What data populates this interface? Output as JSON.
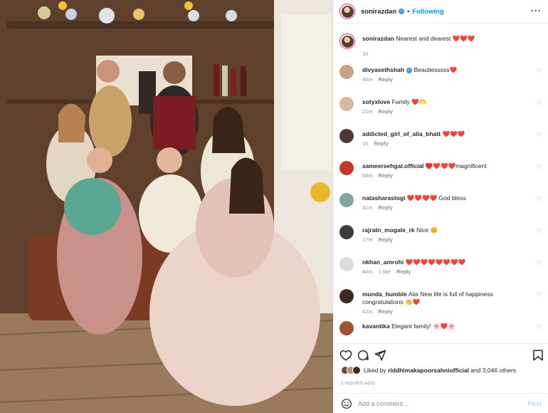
{
  "post": {
    "username": "sonirazdan",
    "follow_state": "Following",
    "more_icon": "more-horizontal-icon"
  },
  "caption": {
    "username": "sonirazdan",
    "text": "Nearest and dearest ❤️❤️❤️",
    "time": "1h"
  },
  "comments": [
    {
      "username": "divyasethshah",
      "verified": true,
      "text": "Beautiesssss❤️",
      "time": "40m",
      "likes": "",
      "reply": "Reply"
    },
    {
      "username": "sotyxlove",
      "verified": false,
      "text": "Family ❤️🫶",
      "time": "21m",
      "likes": "",
      "reply": "Reply"
    },
    {
      "username": "addicted_girl_of_alia_bhatt",
      "verified": false,
      "text": "❤️❤️❤️",
      "time": "1h",
      "likes": "",
      "reply": "Reply"
    },
    {
      "username": "sameersehgal.official",
      "verified": false,
      "text": "♥️❤️❤️❤️magnificent",
      "time": "54m",
      "likes": "",
      "reply": "Reply"
    },
    {
      "username": "natasharastogi",
      "verified": false,
      "text": "❤️❤️❤️❤️ God bless",
      "time": "41m",
      "likes": "",
      "reply": "Reply"
    },
    {
      "username": "rajratn_mogale_rk",
      "verified": false,
      "text": "Nice 😊",
      "time": "17m",
      "likes": "",
      "reply": "Reply"
    },
    {
      "username": "nkhan_amrohi",
      "verified": false,
      "text": "❤️❤️❤️❤️❤️❤️❤️❤️",
      "time": "44m",
      "likes": "1 like",
      "reply": "Reply"
    },
    {
      "username": "munda_humble",
      "verified": false,
      "text": "Alia New life is full of happiness congratulations 👏❤️",
      "time": "42m",
      "likes": "",
      "reply": "Reply"
    },
    {
      "username": "kavantika",
      "verified": false,
      "text": "Elegant family! 🌸❤️🌸",
      "time": "",
      "likes": "",
      "reply": ""
    }
  ],
  "actions": {
    "like_icon": "heart-icon",
    "comment_icon": "comment-icon",
    "share_icon": "send-icon",
    "save_icon": "bookmark-icon"
  },
  "liked_by": {
    "prefix": "Liked by",
    "user": "riddhimakapoorsahniofficial",
    "suffix": "and 3,046 others"
  },
  "timestamp": "2 HOURS AGO",
  "add_comment": {
    "placeholder": "Add a comment...",
    "post_label": "Post",
    "emoji_icon": "smiley-icon"
  },
  "colors": {
    "accent": "#0095f6",
    "verified": "#3897f0",
    "heart": "#ed4956",
    "muted": "#8e8e8e"
  }
}
